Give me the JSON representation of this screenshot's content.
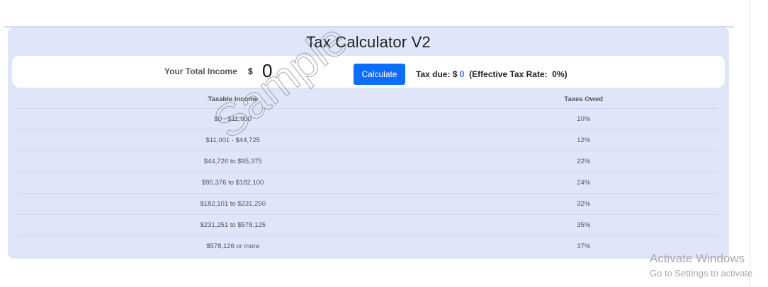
{
  "app": {
    "title": "Tax Calculator V2"
  },
  "income": {
    "label": "Your Total Income",
    "currency_symbol": "$",
    "value": "0"
  },
  "calculate_button": {
    "label": "Calculate",
    "color": "#0d6efd"
  },
  "tax_due": {
    "prefix": "Tax due: $ ",
    "amount": "0",
    "effective_rate_text": "  (Effective Tax Rate:  0%)",
    "amount_color": "#2f6fe6"
  },
  "brackets_table": {
    "headers": [
      "Taxable Income",
      "Taxes Owed"
    ],
    "rows": [
      [
        "$0 - $11,000",
        "10%"
      ],
      [
        "$11,001 - $44,725",
        "12%"
      ],
      [
        "$44,726 to $95,375",
        "22%"
      ],
      [
        "$95,376 to $182,100",
        "24%"
      ],
      [
        "$182,101 to $231,250",
        "32%"
      ],
      [
        "$231,251 to $578,125",
        "35%"
      ],
      [
        "$578,126 or more",
        "37%"
      ]
    ]
  },
  "watermark": {
    "text": "Sample"
  },
  "os_overlay": {
    "line1": "Activate Windows",
    "line2": "Go to Settings to activate"
  },
  "colors": {
    "card_background": "#dfe6fa",
    "accent": "#0d6efd"
  }
}
